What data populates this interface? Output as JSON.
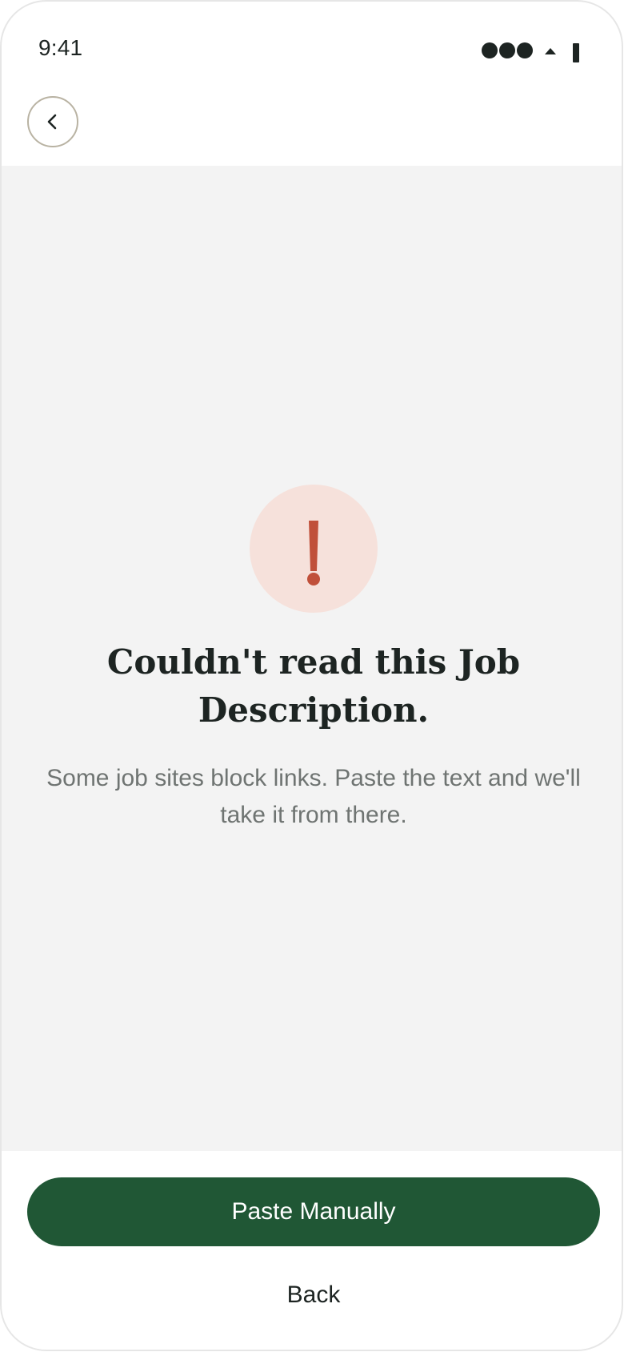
{
  "status_bar": {
    "time": "9:41",
    "signal_icon": "signal-dots-icon",
    "wifi_icon": "wifi-icon",
    "battery_icon": "battery-icon"
  },
  "nav": {
    "back_icon": "chevron-left-icon"
  },
  "error": {
    "icon": "exclamation-icon",
    "icon_color": "#c0503a",
    "icon_bg_color": "#f6e1db",
    "title": "Couldn't read this Job Description.",
    "description": "Some job sites block links. Paste the text and we'll take it from there."
  },
  "actions": {
    "primary_label": "Paste Manually",
    "primary_color": "#205735",
    "secondary_label": "Back"
  }
}
